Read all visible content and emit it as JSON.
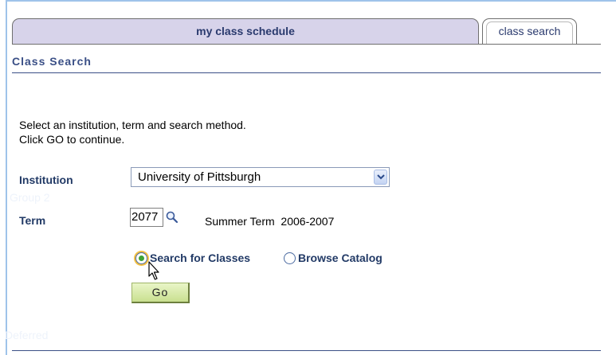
{
  "tabs": {
    "schedule_label": "my class schedule",
    "search_label": "class search"
  },
  "section": {
    "title": "Class Search"
  },
  "instructions": {
    "line1": "Select an institution, term and search method.",
    "line2": "Click GO to continue."
  },
  "form": {
    "institution_label": "Institution",
    "institution_value": "University of Pittsburgh",
    "term_label": "Term",
    "term_value": "2077",
    "term_description": "Summer Term  2006-2007",
    "faint_group_label": "Group 2",
    "faint_deferred_label": "Deferred"
  },
  "search_method": {
    "option1": "Search for Classes",
    "option2": "Browse Catalog",
    "selected": "Search for Classes"
  },
  "buttons": {
    "go_label": "Go"
  },
  "icons": {
    "lookup": "magnifier-icon",
    "dropdown": "chevron-down-icon",
    "cursor": "mouse-pointer-icon"
  },
  "colors": {
    "accent": "#3a4f86",
    "tab_inactive": "#d7d3ea",
    "go_button": "#c9e090",
    "radio_selected": "#3ea336"
  }
}
